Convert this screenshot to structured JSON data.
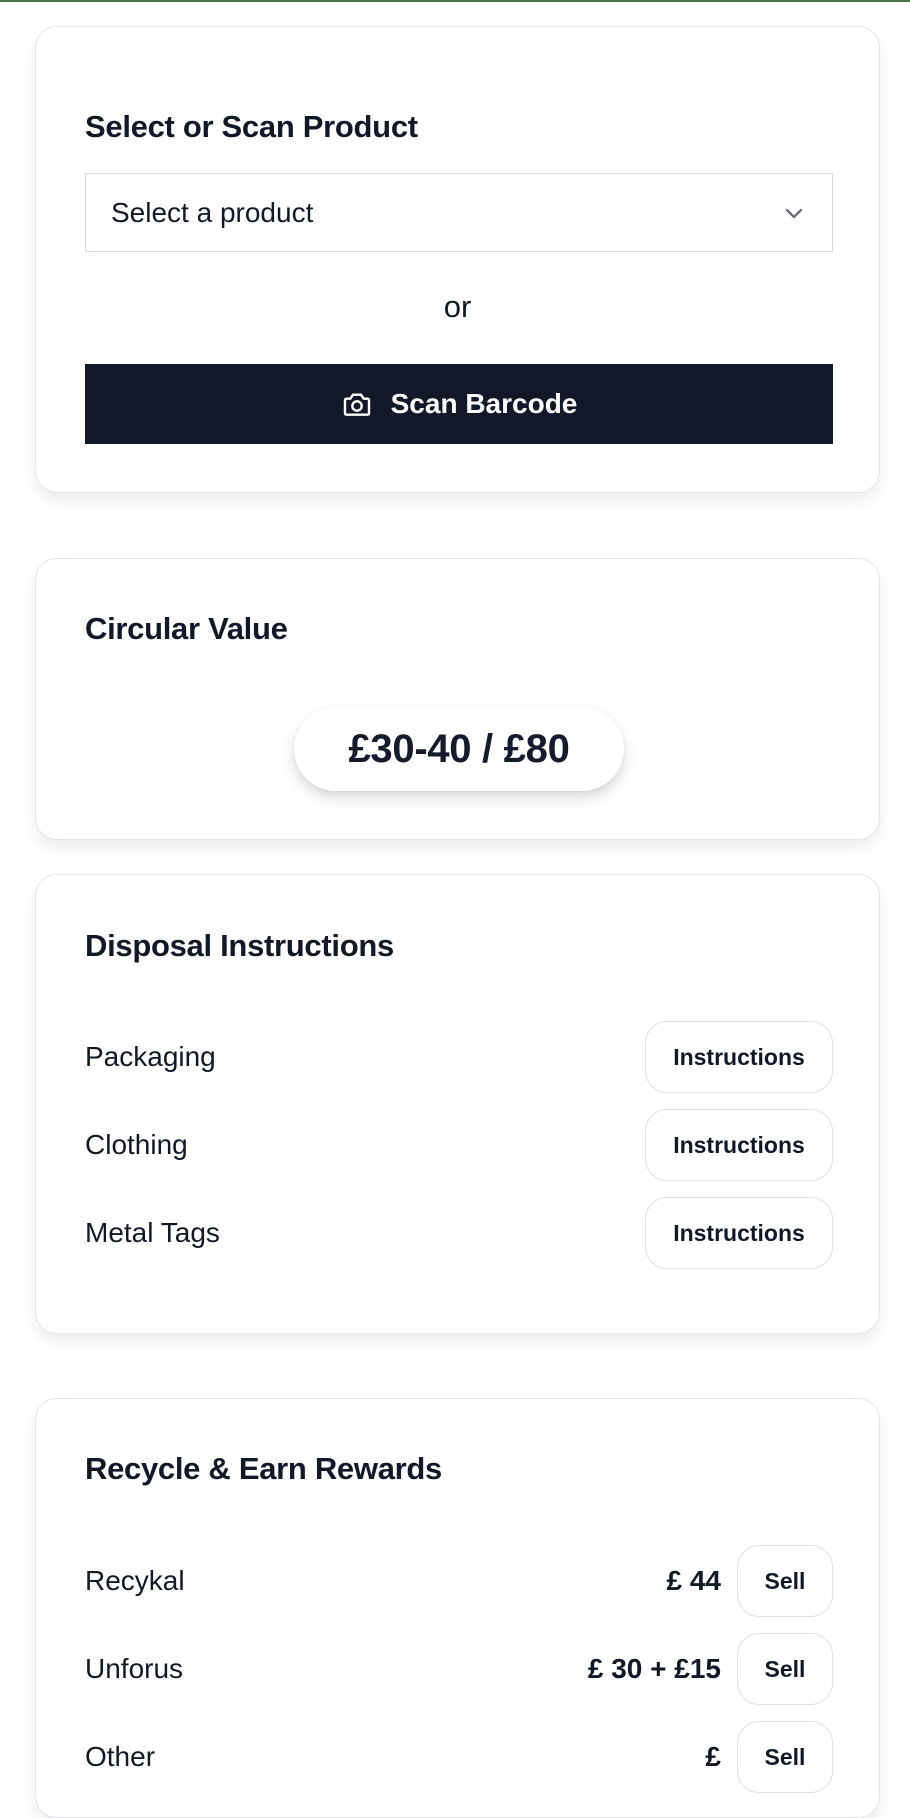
{
  "select_card": {
    "title": "Select or Scan Product",
    "dropdown_value": "Select a product",
    "or_text": "or",
    "scan_label": "Scan Barcode"
  },
  "value_card": {
    "title": "Circular Value",
    "value": "£30-40 / £80"
  },
  "disposal_card": {
    "title": "Disposal Instructions",
    "items": [
      {
        "label": "Packaging",
        "button": "Instructions"
      },
      {
        "label": "Clothing",
        "button": "Instructions"
      },
      {
        "label": "Metal Tags",
        "button": "Instructions"
      }
    ]
  },
  "recycle_card": {
    "title": "Recycle & Earn Rewards",
    "items": [
      {
        "label": "Recykal",
        "price": "£ 44",
        "button": "Sell"
      },
      {
        "label": "Unforus",
        "price": "£ 30 + £15",
        "button": "Sell"
      },
      {
        "label": "Other",
        "price": "£",
        "button": "Sell"
      }
    ]
  },
  "icons": {
    "dropdown": "chevron-down-icon",
    "scan": "camera-icon"
  },
  "colors": {
    "primary_button": "#121828",
    "top_accent": "#4a7a4a",
    "border": "#e2e5ec"
  }
}
